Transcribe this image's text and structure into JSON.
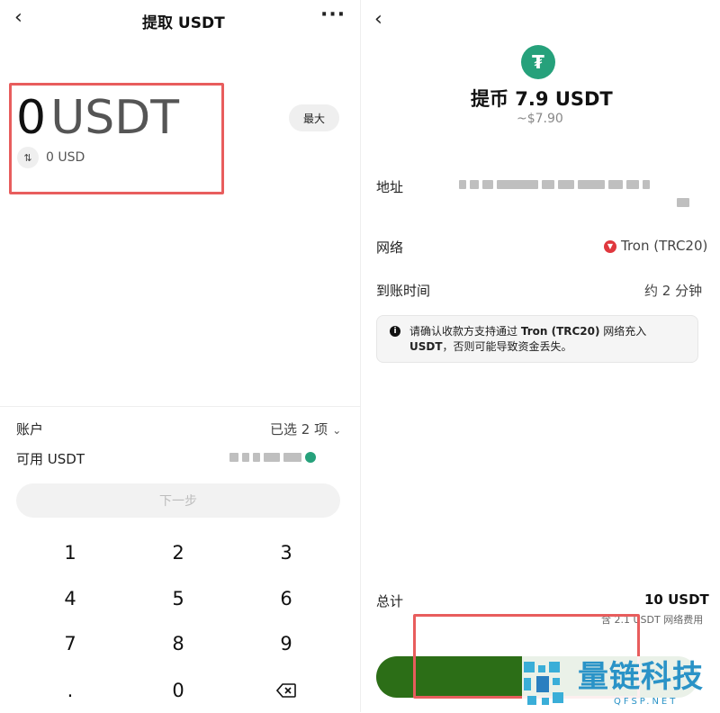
{
  "left": {
    "header": {
      "back_icon": "chevron-left-icon",
      "title": "提取 USDT",
      "more_icon": "more-horizontal-icon"
    },
    "amount": {
      "value": "0",
      "unit": "USDT",
      "usd_value": "0 USD",
      "max_label": "最大",
      "swap_icon": "swap-vertical-icon"
    },
    "account": {
      "label": "账户",
      "value": "已选 2 项"
    },
    "available": {
      "label": "可用 USDT"
    },
    "next_label": "下一步",
    "keypad": [
      "1",
      "2",
      "3",
      "4",
      "5",
      "6",
      "7",
      "8",
      "9",
      ".",
      "0"
    ],
    "backspace_icon": "backspace-icon"
  },
  "right": {
    "header": {
      "back_icon": "chevron-left-icon"
    },
    "title": "提币 7.9 USDT",
    "subtitle": "~$7.90",
    "address_label": "地址",
    "network": {
      "label": "网络",
      "value": "Tron (TRC20)"
    },
    "arrival": {
      "label": "到账时间",
      "value": "约 2 分钟"
    },
    "notice": {
      "part1": "请确认收款方支持通过 ",
      "bold1": "Tron (TRC20)",
      "part2": " 网络充入 ",
      "bold2": "USDT",
      "part3": "，否则可能导致资金丢失。"
    },
    "total": {
      "label": "总计",
      "value": "10 USDT",
      "fee_note": "含 2.1 USDT 网络费用"
    }
  },
  "watermark": {
    "title": "量链科技",
    "domain": "QFSP.NET"
  },
  "colors": {
    "usdt_green": "#26a17b",
    "highlight_red": "#e85d5d",
    "confirm_green": "#2c6e17",
    "tron_red": "#e0383e",
    "watermark_blue": "#2a93c7"
  }
}
